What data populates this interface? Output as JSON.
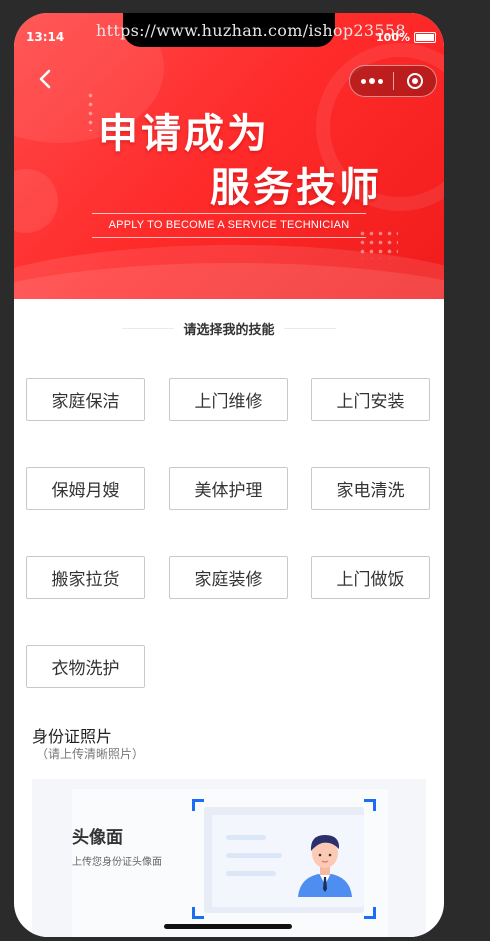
{
  "watermark": "https://www.huzhan.com/ishop23558",
  "status_bar": {
    "time": "13:14",
    "battery": "100%"
  },
  "banner": {
    "title_line1": "申请成为",
    "title_line2": "服务技师",
    "subtitle": "APPLY TO BECOME A SERVICE TECHNICIAN"
  },
  "nav": {
    "back_icon": "chevron-left-icon",
    "more_icon": "more-dots-icon",
    "close_icon": "target-close-icon"
  },
  "skills_section": {
    "title": "请选择我的技能",
    "skills": [
      "家庭保洁",
      "上门维修",
      "上门安装",
      "保姆月嫂",
      "美体护理",
      "家电清洗",
      "搬家拉货",
      "家庭装修",
      "上门做饭",
      "衣物洗护"
    ]
  },
  "id_section": {
    "title": "身份证照片",
    "subtitle": "（请上传清晰照片）",
    "upload_label": "头像面",
    "upload_hint": "上传您身份证头像面"
  },
  "colors": {
    "banner_red": "#ff2a2a",
    "corner_blue": "#1a6ef5"
  }
}
